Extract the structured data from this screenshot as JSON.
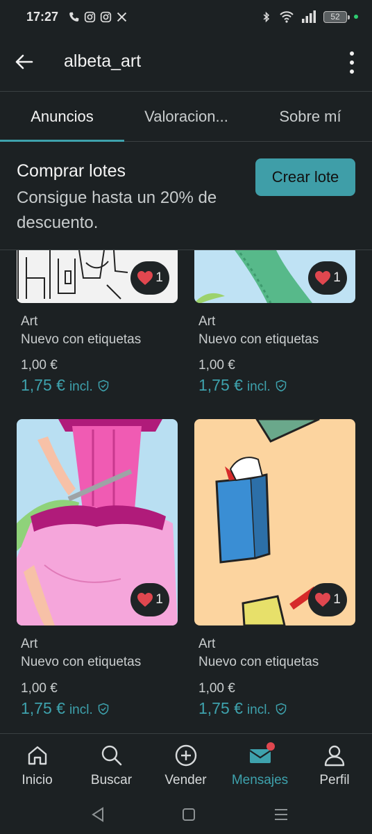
{
  "status_bar": {
    "time": "17:27",
    "battery": "52"
  },
  "header": {
    "title": "albeta_art"
  },
  "tabs": [
    {
      "label": "Anuncios"
    },
    {
      "label": "Valoracion..."
    },
    {
      "label": "Sobre mí"
    }
  ],
  "banner": {
    "title": "Comprar lotes",
    "subtitle": "Consigue hasta un 20% de descuento.",
    "button": "Crear lote"
  },
  "items": [
    {
      "likes": "1",
      "brand": "Art",
      "condition": "Nuevo con etiquetas",
      "price": "1,00 €",
      "price_incl": "1,75 €",
      "incl_label": "incl."
    },
    {
      "likes": "1",
      "brand": "Art",
      "condition": "Nuevo con etiquetas",
      "price": "1,00 €",
      "price_incl": "1,75 €",
      "incl_label": "incl."
    },
    {
      "likes": "1",
      "brand": "Art",
      "condition": "Nuevo con etiquetas",
      "price": "1,00 €",
      "price_incl": "1,75 €",
      "incl_label": "incl."
    },
    {
      "likes": "1",
      "brand": "Art",
      "condition": "Nuevo con etiquetas",
      "price": "1,00 €",
      "price_incl": "1,75 €",
      "incl_label": "incl."
    }
  ],
  "bottom_nav": [
    {
      "label": "Inicio",
      "icon": "home-icon"
    },
    {
      "label": "Buscar",
      "icon": "search-icon"
    },
    {
      "label": "Vender",
      "icon": "plus-circle-icon"
    },
    {
      "label": "Mensajes",
      "icon": "mail-icon",
      "active": true
    },
    {
      "label": "Perfil",
      "icon": "person-icon"
    }
  ],
  "colors": {
    "accent": "#3ea2ad",
    "background": "#1c2123",
    "badge": "#e0474f",
    "heart": "#e0474f"
  }
}
